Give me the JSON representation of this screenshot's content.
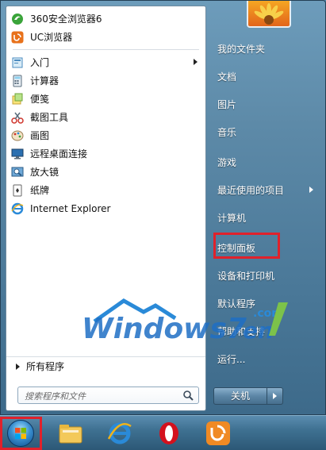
{
  "start_menu": {
    "pinned": [
      {
        "label": "360安全浏览器6",
        "icon": "360-browser-icon",
        "color": "#3aa43a"
      },
      {
        "label": "UC浏览器",
        "icon": "uc-browser-icon",
        "color": "#e8721c"
      }
    ],
    "recent": [
      {
        "label": "入门",
        "icon": "getting-started-icon",
        "has_submenu": true
      },
      {
        "label": "计算器",
        "icon": "calculator-icon"
      },
      {
        "label": "便笺",
        "icon": "sticky-notes-icon"
      },
      {
        "label": "截图工具",
        "icon": "snipping-tool-icon"
      },
      {
        "label": "画图",
        "icon": "paint-icon"
      },
      {
        "label": "远程桌面连接",
        "icon": "remote-desktop-icon"
      },
      {
        "label": "放大镜",
        "icon": "magnifier-icon"
      },
      {
        "label": "纸牌",
        "icon": "solitaire-icon"
      },
      {
        "label": "Internet Explorer",
        "icon": "ie-icon"
      }
    ],
    "all_programs_label": "所有程序",
    "search": {
      "placeholder": "搜索程序和文件"
    },
    "right_items": [
      {
        "label": "我的文件夹"
      },
      {
        "label": "文档"
      },
      {
        "label": "图片"
      },
      {
        "label": "音乐"
      },
      {
        "label": "游戏"
      },
      {
        "label": "最近使用的项目",
        "has_submenu": true
      },
      {
        "label": "计算机"
      },
      {
        "label": "控制面板",
        "highlighted": true
      },
      {
        "label": "设备和打印机"
      },
      {
        "label": "默认程序"
      },
      {
        "label": "帮助和支持"
      },
      {
        "label": "运行..."
      }
    ],
    "shutdown_label": "关机"
  },
  "watermark": {
    "text_main": "Windows7",
    "text_suffix": "en",
    "text_com": ".com"
  },
  "taskbar": {
    "items": [
      {
        "icon": "start-orb-icon"
      },
      {
        "icon": "file-explorer-icon"
      },
      {
        "icon": "internet-explorer-icon"
      },
      {
        "icon": "opera-icon"
      },
      {
        "icon": "uc-browser-icon"
      }
    ]
  },
  "colors": {
    "highlight_border": "#e0212b",
    "accent": "#3d6a8a"
  }
}
